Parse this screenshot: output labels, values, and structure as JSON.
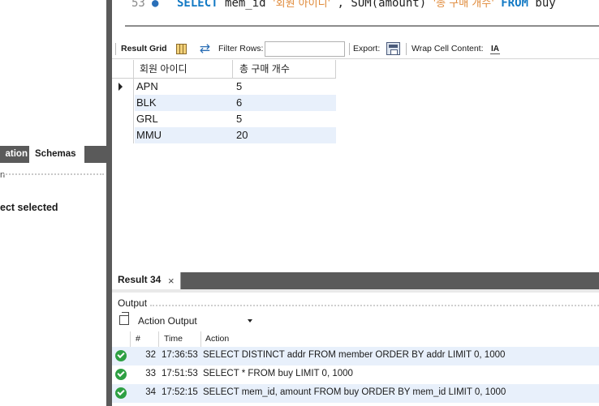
{
  "left_panel": {
    "tab_partial": "ation",
    "tab_schemas": "Schemas",
    "dotted_lead": "n",
    "status_text": "ect selected"
  },
  "editor": {
    "line_number": "53",
    "sql_parts": {
      "select": "SELECT",
      "col1": "mem_id",
      "alias1": "'회원 아이디'",
      "comma": " , ",
      "sum": "SUM(amount)",
      "alias2": "'총 구매 개수'",
      "from": "FROM",
      "table": "buy"
    }
  },
  "toolbar": {
    "result_grid": "Result Grid",
    "filter_label": "Filter Rows:",
    "filter_value": "",
    "export_label": "Export:",
    "wrap_label": "Wrap Cell Content:",
    "wrap_icon": "IA"
  },
  "result_grid": {
    "columns": [
      "회원 아이디",
      "총 구매 개수"
    ],
    "rows": [
      [
        "APN",
        "5"
      ],
      [
        "BLK",
        "6"
      ],
      [
        "GRL",
        "5"
      ],
      [
        "MMU",
        "20"
      ]
    ]
  },
  "result_tab": {
    "label": "Result 34",
    "close": "×"
  },
  "output": {
    "title": "Output",
    "selector_value": "Action Output",
    "columns": [
      "#",
      "Time",
      "Action"
    ],
    "rows": [
      {
        "num": "32",
        "time": "17:36:53",
        "action": "SELECT DISTINCT addr FROM member ORDER BY addr LIMIT 0, 1000",
        "status": "success"
      },
      {
        "num": "33",
        "time": "17:51:53",
        "action": "SELECT * FROM buy LIMIT 0, 1000",
        "status": "success"
      },
      {
        "num": "34",
        "time": "17:52:15",
        "action": "SELECT mem_id, amount FROM buy ORDER BY mem_id LIMIT 0, 1000",
        "status": "success"
      }
    ]
  },
  "icons": {
    "grid": "grid-icon",
    "refresh": "refresh-icon",
    "export": "export-icon",
    "wrap": "wrap-cell-icon",
    "copy": "copy-icon",
    "status_ok": "success-check-icon",
    "row_pointer": "row-pointer-icon"
  },
  "colors": {
    "keyword": "#1279c4",
    "string": "#e08a3a",
    "alt_row": "#e8f0fb",
    "splitter": "#5a5a5a",
    "success": "#2ea043"
  }
}
